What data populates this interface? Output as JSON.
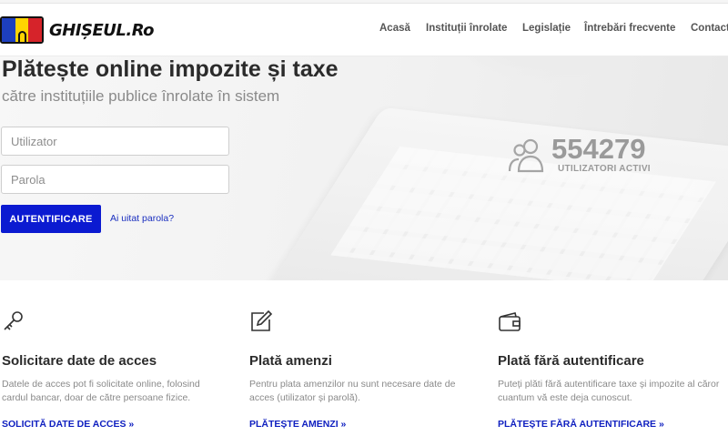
{
  "brand": {
    "name": "GHIȘEUL.Ro",
    "colors": [
      "#1d3fbf",
      "#ffd400",
      "#d6232a"
    ]
  },
  "nav": {
    "items": [
      {
        "label": "Acasă"
      },
      {
        "label": "Instituții înrolate"
      },
      {
        "label": "Legislație"
      },
      {
        "label": "Întrebări frecvente"
      },
      {
        "label": "Contact"
      }
    ]
  },
  "hero": {
    "title": "Plătește online impozite și taxe",
    "subtitle": "către instituțiile publice înrolate în sistem",
    "login": {
      "username_placeholder": "Utilizator",
      "password_placeholder": "Parola",
      "submit_label": "AUTENTIFICARE",
      "forgot_label": "Ai uitat parola?"
    },
    "stats": {
      "count": "554279",
      "label": "UTILIZATORI ACTIVI",
      "icon": "users-icon"
    }
  },
  "features": [
    {
      "icon": "key-icon",
      "title": "Solicitare date de acces",
      "text": "Datele de acces pot fi solicitate online, folosind cardul bancar, doar de către persoane fizice.",
      "link": "SOLICITĂ DATE DE ACCES »"
    },
    {
      "icon": "edit-icon",
      "title": "Plată amenzi",
      "text": "Pentru plata amenzilor nu sunt necesare date de acces (utilizator și parolă).",
      "link": "PLĂTEȘTE AMENZI »"
    },
    {
      "icon": "wallet-icon",
      "title": "Plată fără autentificare",
      "text": "Puteți plăti fără autentificare taxe și impozite al căror cuantum vă este deja cunoscut.",
      "link": "PLĂTEȘTE FĂRĂ AUTENTIFICARE »"
    }
  ],
  "accent_color": "#0b1ad1"
}
